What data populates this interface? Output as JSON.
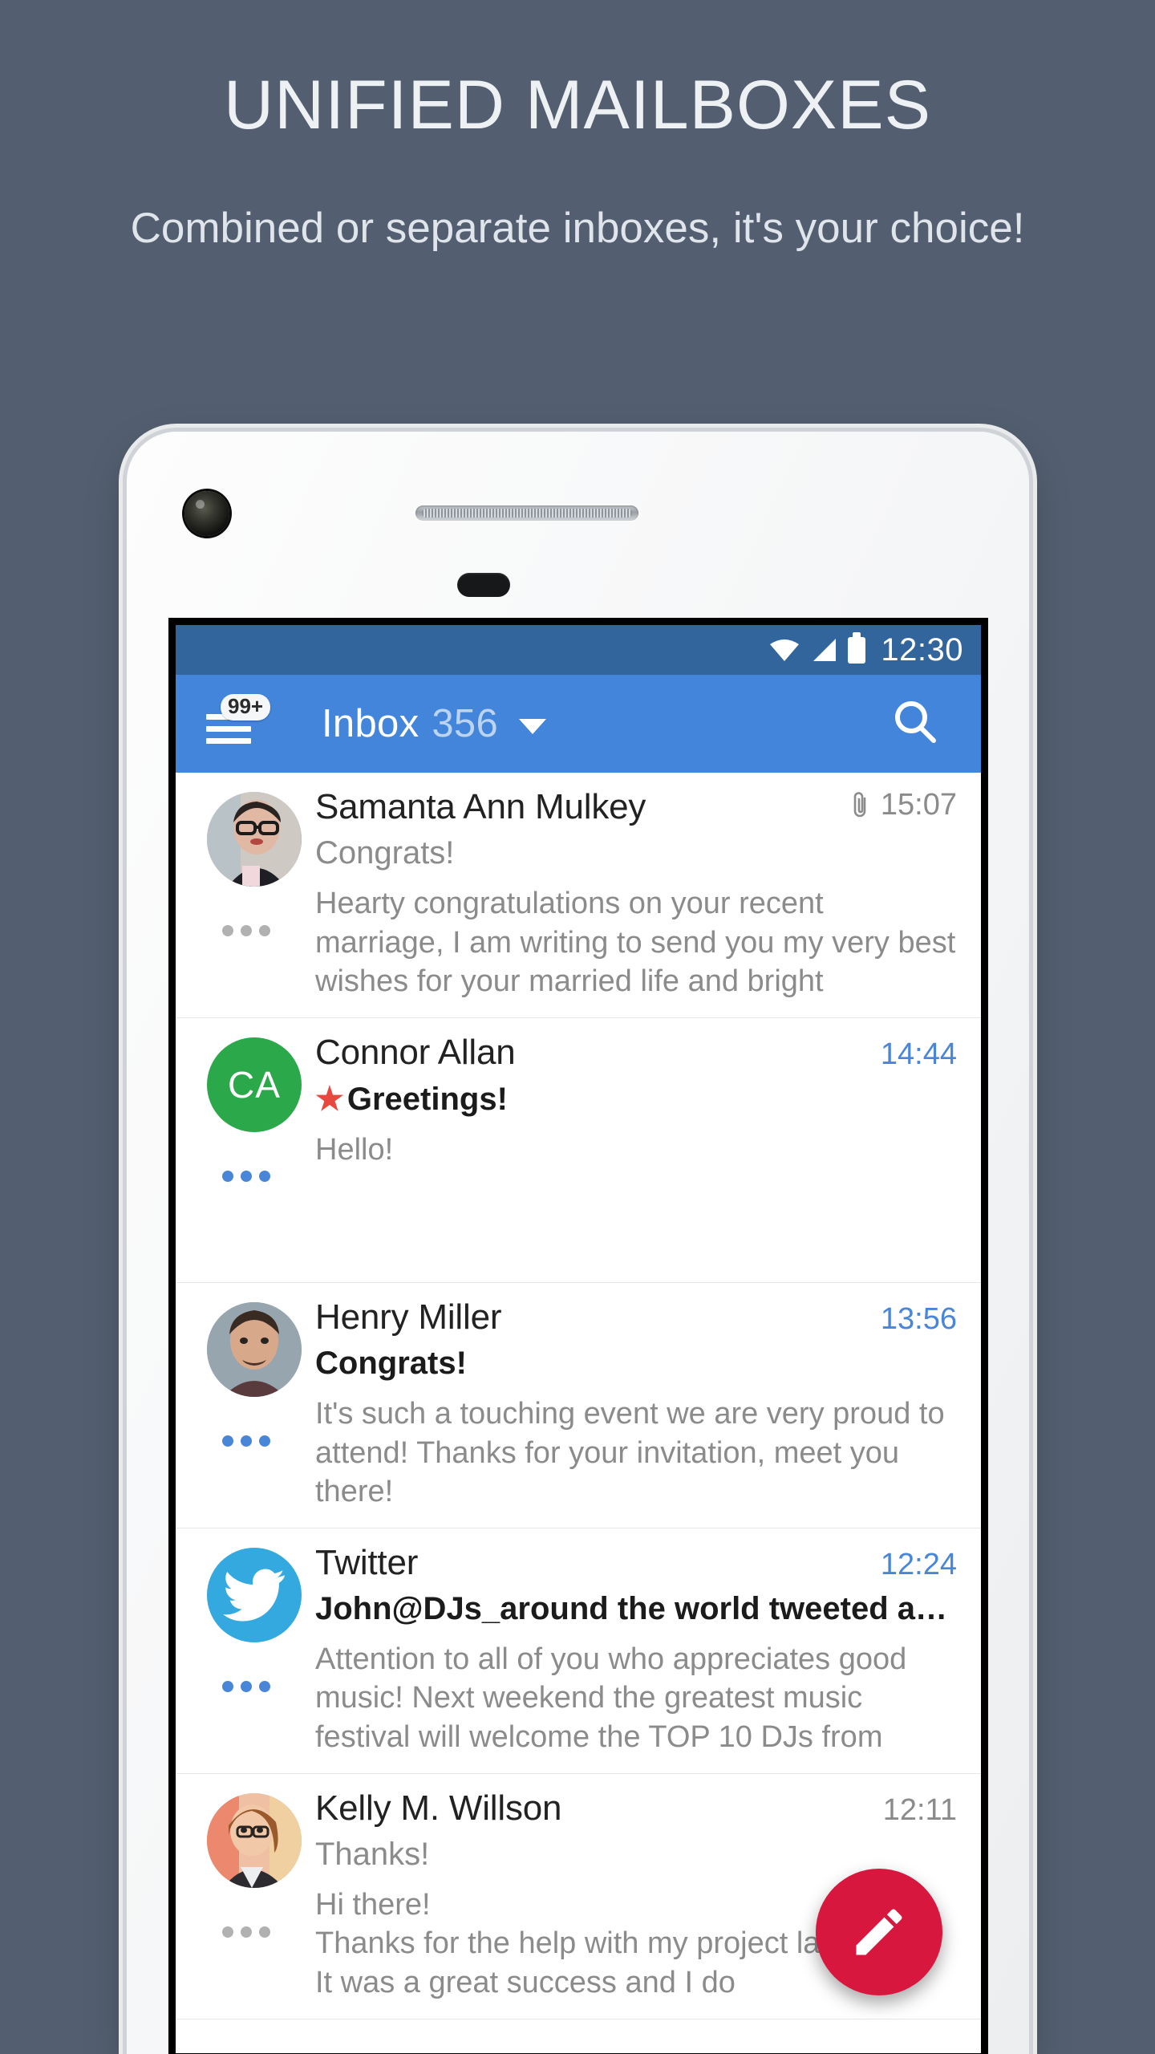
{
  "hero": {
    "title": "UNIFIED MAILBOXES",
    "subtitle": "Combined or separate inboxes, it's your choice!"
  },
  "colors": {
    "background": "#535f70",
    "statusbar": "#32659c",
    "toolbar": "#4285db",
    "accent_unread": "#4a86d8",
    "fab": "#d8173f",
    "star": "#e8493f",
    "avatar_green": "#2aa84a",
    "avatar_twitter": "#34a9e0"
  },
  "phone": {
    "statusbar": {
      "wifi_icon": "wifi-icon",
      "signal_icon": "signal-icon",
      "battery_icon": "battery-icon",
      "time": "12:30"
    },
    "toolbar": {
      "menu_icon": "hamburger-menu-icon",
      "menu_badge": "99+",
      "title": "Inbox",
      "count": "356",
      "dropdown_icon": "chevron-down-icon",
      "search_icon": "search-icon"
    },
    "fab": {
      "icon": "compose-pencil-icon",
      "label": "Compose"
    },
    "emails": [
      {
        "avatar_type": "photo",
        "avatar_initials": "",
        "sender": "Samanta Ann Mulkey",
        "subject": "Congrats!",
        "snippet": "Hearty congratulations on your recent marriage, I am writing to send you my very best wishes for your married life and bright",
        "time": "15:07",
        "unread": false,
        "starred": false,
        "has_attachment": true
      },
      {
        "avatar_type": "initials",
        "avatar_initials": "CA",
        "sender": "Connor Allan",
        "subject": "Greetings!",
        "snippet": "Hello!",
        "time": "14:44",
        "unread": true,
        "starred": true,
        "has_attachment": false
      },
      {
        "avatar_type": "photo",
        "avatar_initials": "",
        "sender": "Henry Miller",
        "subject": "Congrats!",
        "snippet": "It's such a touching event we are very proud to attend! Thanks for your invitation, meet you there!",
        "time": "13:56",
        "unread": true,
        "starred": false,
        "has_attachment": false
      },
      {
        "avatar_type": "twitter",
        "avatar_initials": "",
        "sender": "Twitter",
        "subject": "John@DJs_around the world tweeted abo...",
        "snippet": "Attention to all of you who appreciates good music! Next weekend the greatest music festival will welcome the TOP 10 DJs from",
        "time": "12:24",
        "unread": true,
        "starred": false,
        "has_attachment": false
      },
      {
        "avatar_type": "photo",
        "avatar_initials": "",
        "sender": "Kelly M. Willson",
        "subject": "Thanks!",
        "snippet": "Hi there!\nThanks for the help with my project last week. It was a great success and I do",
        "time": "12:11",
        "unread": false,
        "starred": false,
        "has_attachment": false
      }
    ]
  }
}
